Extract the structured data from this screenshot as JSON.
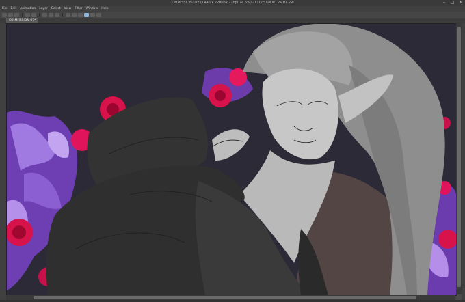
{
  "app": {
    "title": "COMMISSION-07* (1440 x 2200px 72dpi 74.6%) - CLIP STUDIO PAINT PRO",
    "document_tab": "COMMISSION-07*"
  },
  "menu": [
    "File",
    "Edit",
    "Animation",
    "Layer",
    "Select",
    "View",
    "Filter",
    "Window",
    "Help"
  ],
  "colors": {
    "background": "#2b2a36",
    "roses": "#d8124a",
    "foliage": "#8a5ad0",
    "sketch_gray": "#a9a9a9",
    "dark_clothing": "#2f2f2f",
    "cloak_brown": "#5a4a46"
  },
  "window_controls": {
    "minimize": "–",
    "maximize": "□",
    "close": "✕"
  }
}
